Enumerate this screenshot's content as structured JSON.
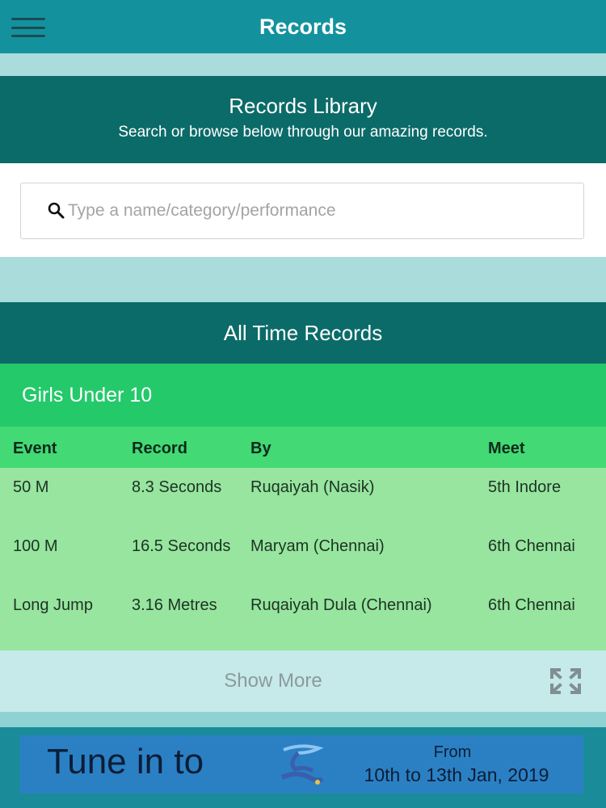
{
  "header": {
    "title": "Records",
    "menu_icon": "hamburger-menu-icon"
  },
  "library": {
    "title": "Records Library",
    "subtitle": "Search or browse below through our amazing records."
  },
  "search": {
    "placeholder": "Type a name/category/performance",
    "value": "",
    "icon": "search-icon"
  },
  "all_time": {
    "title": "All Time Records"
  },
  "category": {
    "title": "Girls Under 10",
    "columns": [
      "Event",
      "Record",
      "By",
      "Meet"
    ],
    "rows": [
      {
        "event": "50 M",
        "record": "8.3 Seconds",
        "by": "Ruqaiyah (Nasik)",
        "meet": "5th Indore"
      },
      {
        "event": "100 M",
        "record": "16.5 Seconds",
        "by": "Maryam (Chennai)",
        "meet": "6th Chennai"
      },
      {
        "event": "Long Jump",
        "record": "3.16 Metres",
        "by": "Ruqaiyah Dula (Chennai)",
        "meet": "6th Chennai"
      }
    ]
  },
  "show_more": {
    "label": "Show More",
    "icon": "expand-icon"
  },
  "banner": {
    "text": "Tune in to",
    "from_label": "From",
    "dates": "10th to 13th Jan, 2019"
  },
  "colors": {
    "topbar": "#13929e",
    "dark_teal": "#0b6b69",
    "category_green": "#24c96a",
    "header_green": "#43d975",
    "row_green": "#97e59f",
    "banner_blue": "#2b80c4"
  }
}
